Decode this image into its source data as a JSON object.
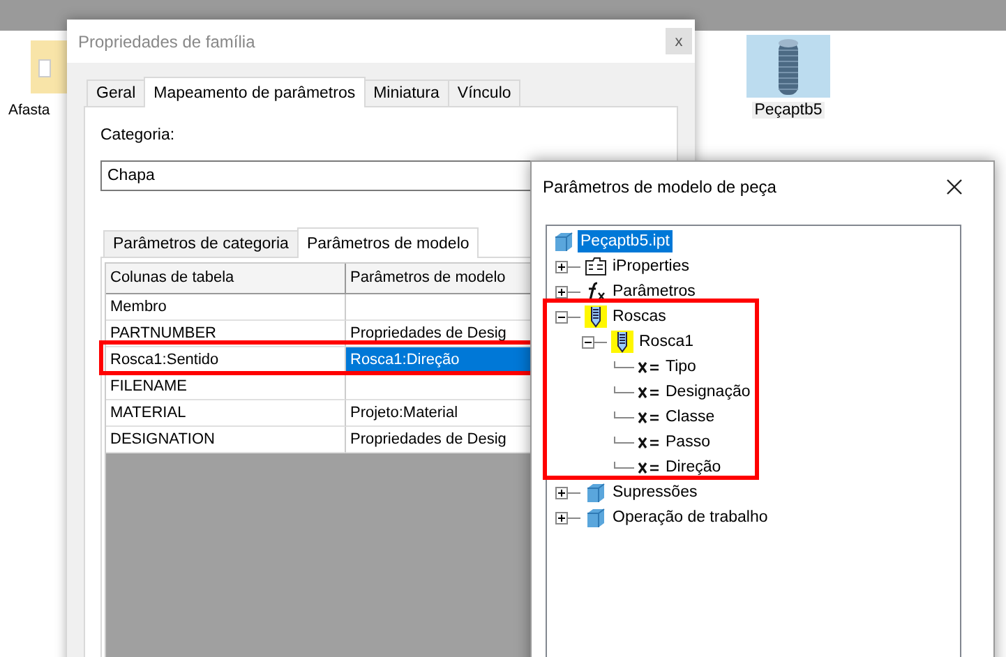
{
  "desktop": {
    "icons": [
      {
        "label": "Afasta",
        "kind": "folder",
        "selected": false
      },
      {
        "label": "Peçaptb5",
        "kind": "part",
        "selected": true
      }
    ]
  },
  "family_dialog": {
    "title": "Propriedades de família",
    "close": "x",
    "tabs": [
      {
        "label": "Geral",
        "selected": false
      },
      {
        "label": "Mapeamento de parâmetros",
        "selected": true
      },
      {
        "label": "Miniatura",
        "selected": false
      },
      {
        "label": "Vínculo",
        "selected": false
      }
    ],
    "category_label": "Categoria:",
    "category_value": "Chapa",
    "sub_tabs": [
      {
        "label": "Parâmetros de categoria",
        "selected": false
      },
      {
        "label": "Parâmetros de modelo",
        "selected": true
      }
    ],
    "table": {
      "columns": [
        "Colunas de tabela",
        "Parâmetros de modelo"
      ],
      "rows": [
        {
          "cells": [
            "Membro",
            ""
          ],
          "selected": false
        },
        {
          "cells": [
            "PARTNUMBER",
            "Propriedades de Desig"
          ],
          "selected": false
        },
        {
          "cells": [
            "Rosca1:Sentido",
            "Rosca1:Direção"
          ],
          "selected": true
        },
        {
          "cells": [
            "FILENAME",
            ""
          ],
          "selected": false
        },
        {
          "cells": [
            "MATERIAL",
            "Projeto:Material"
          ],
          "selected": false
        },
        {
          "cells": [
            "DESIGNATION",
            "Propriedades de Desig"
          ],
          "selected": false
        }
      ]
    }
  },
  "parts_dialog": {
    "title": "Parâmetros de modelo de peça",
    "tree": [
      {
        "label": "Peçaptb5.ipt",
        "kind": "part",
        "selected": true,
        "children": [
          {
            "label": "iProperties",
            "kind": "properties",
            "selected": false,
            "expanded": false
          },
          {
            "label": "Parâmetros",
            "kind": "function",
            "selected": false,
            "expanded": false
          },
          {
            "label": "Roscas",
            "kind": "thread",
            "selected": false,
            "expanded": true,
            "children": [
              {
                "label": "Rosca1",
                "kind": "thread",
                "selected": false,
                "expanded": true,
                "children": [
                  {
                    "label": "Tipo",
                    "kind": "parameter",
                    "selected": false
                  },
                  {
                    "label": "Designação",
                    "kind": "parameter",
                    "selected": false
                  },
                  {
                    "label": "Classe",
                    "kind": "parameter",
                    "selected": false
                  },
                  {
                    "label": "Passo",
                    "kind": "parameter",
                    "selected": false
                  },
                  {
                    "label": "Direção",
                    "kind": "parameter",
                    "selected": false
                  }
                ]
              }
            ]
          },
          {
            "label": "Supressões",
            "kind": "part",
            "selected": false,
            "expanded": false
          },
          {
            "label": "Operação de trabalho",
            "kind": "part",
            "selected": false,
            "expanded": false
          }
        ]
      }
    ]
  }
}
